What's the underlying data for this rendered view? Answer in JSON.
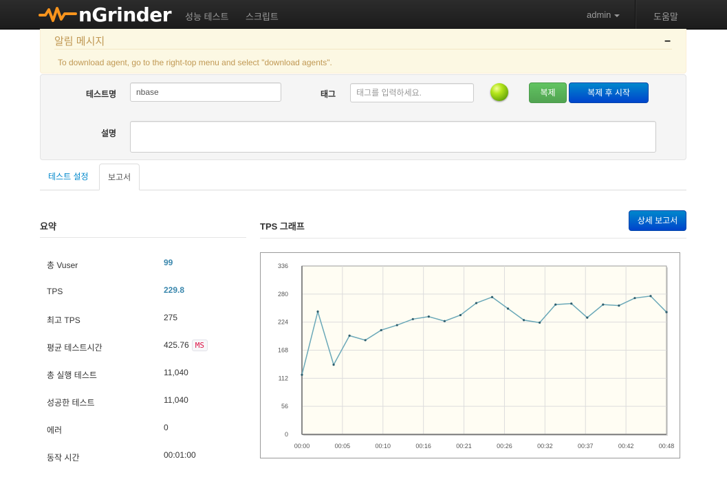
{
  "nav": {
    "brand": "nGrinder",
    "links": [
      "성능 테스트",
      "스크립트"
    ],
    "user": "admin",
    "help": "도움말"
  },
  "alert": {
    "title": "알림 메시지",
    "collapse": "–",
    "message": "To download agent, go to the right-top menu and select \"download agents\"."
  },
  "form": {
    "test_name_label": "테스트명",
    "test_name_value": "nbase",
    "tag_label": "태그",
    "tag_placeholder": "태그를 입력하세요.",
    "desc_label": "설명",
    "copy_button": "복제",
    "copy_start_button": "복제 후 시작"
  },
  "tabs": [
    "테스트 설정",
    "보고서"
  ],
  "summary": {
    "title": "요약",
    "rows": [
      {
        "label": "총 Vuser",
        "value": "99"
      },
      {
        "label": "TPS",
        "value": "229.8"
      },
      {
        "label": "최고 TPS",
        "value": "275"
      },
      {
        "label": "평균 테스트시간",
        "value": "425.76",
        "unit": "MS"
      },
      {
        "label": "총 실행 테스트",
        "value": "11,040"
      },
      {
        "label": "성공한 테스트",
        "value": "11,040"
      },
      {
        "label": "에러",
        "value": "0"
      },
      {
        "label": "동작 시간",
        "value": "00:01:00"
      }
    ]
  },
  "graph": {
    "title": "TPS 그래프",
    "detail_button": "상세 보고서"
  },
  "colors": {
    "navbar": "#1b1b1b",
    "alert_bg": "#fcf8e3",
    "alert_text": "#c09853",
    "accent_blue": "#0088cc",
    "highlight_value": "#3a87ad",
    "line": "#6aa8b8",
    "plot_bg": "#fffdf3",
    "status_ball": "#b5e61d"
  },
  "chart_data": {
    "type": "line",
    "title": "",
    "xlabel": "",
    "ylabel": "",
    "ylim": [
      0,
      336
    ],
    "yticks": [
      "0",
      "56",
      "112",
      "168",
      "224",
      "280",
      "336"
    ],
    "xticks": [
      "00:00",
      "00:05",
      "00:10",
      "00:16",
      "00:21",
      "00:26",
      "00:32",
      "00:37",
      "00:42",
      "00:48"
    ],
    "grid": true,
    "series": [
      {
        "values": [
          119,
          245,
          139,
          197,
          188,
          208,
          218,
          230,
          235,
          226,
          238,
          262,
          274,
          251,
          228,
          223,
          259,
          261,
          233,
          259,
          257,
          272,
          276,
          244
        ]
      }
    ]
  }
}
